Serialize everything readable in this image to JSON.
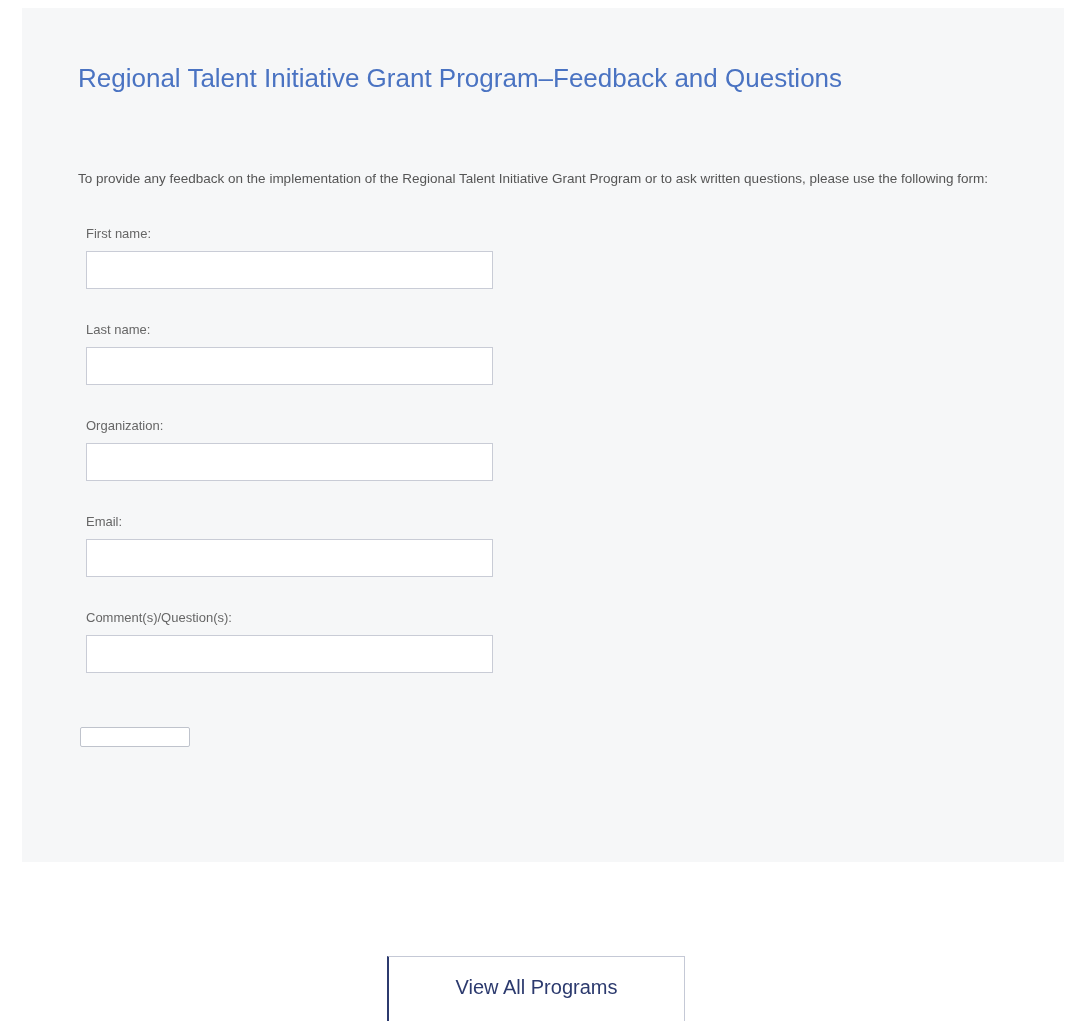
{
  "form": {
    "title": "Regional Talent Initiative Grant Program–Feedback and Questions",
    "intro": "To provide any feedback on the implementation of the Regional Talent Initiative Grant Program or to ask written questions, please use the following form:",
    "fields": [
      {
        "label": "First name:"
      },
      {
        "label": "Last name:"
      },
      {
        "label": "Organization:"
      },
      {
        "label": "Email:"
      },
      {
        "label": "Comment(s)/Question(s):"
      }
    ]
  },
  "view_all_button": {
    "label": "View All Programs"
  }
}
